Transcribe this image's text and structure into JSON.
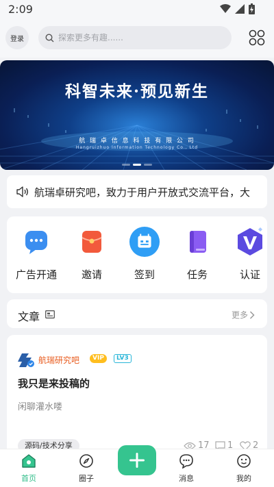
{
  "status": {
    "time": "2:09"
  },
  "header": {
    "login_label": "登录",
    "search_placeholder": "探索更多有趣......"
  },
  "banner": {
    "title": "科智未来·预见新生",
    "company_cn": "航 瑞 卓 信 息 科 技 有 限 公 司",
    "company_en": "Hangruizhuo Information Technology Co., Ltd"
  },
  "notice": {
    "text": "航瑞卓研究吧，致力于用户开放式交流平台，大"
  },
  "shortcuts": [
    {
      "label": "广告开通",
      "icon": "chat-bubble-icon",
      "color": "#3b8ef0"
    },
    {
      "label": "邀请",
      "icon": "red-envelope-icon",
      "color": "#f25a3c"
    },
    {
      "label": "签到",
      "icon": "calendar-checkin-icon",
      "color": "#2f9ef5"
    },
    {
      "label": "任务",
      "icon": "book-icon",
      "color": "#8a5cf2"
    },
    {
      "label": "认证",
      "icon": "verified-v-icon",
      "color": "#5b4ae0"
    }
  ],
  "articles": {
    "title": "文章",
    "more": "更多"
  },
  "post": {
    "forum": "航瑞研究吧",
    "vip": "VIP",
    "level": "LV3",
    "title": "我只是来投稿的",
    "subtitle": "闲聊灌水喽",
    "tag": "源码/技术分享",
    "views": "17",
    "comments": "1",
    "likes": "2"
  },
  "nav": {
    "home": "首页",
    "circle": "圈子",
    "messages": "消息",
    "me": "我的",
    "accent": "#35c48f"
  }
}
